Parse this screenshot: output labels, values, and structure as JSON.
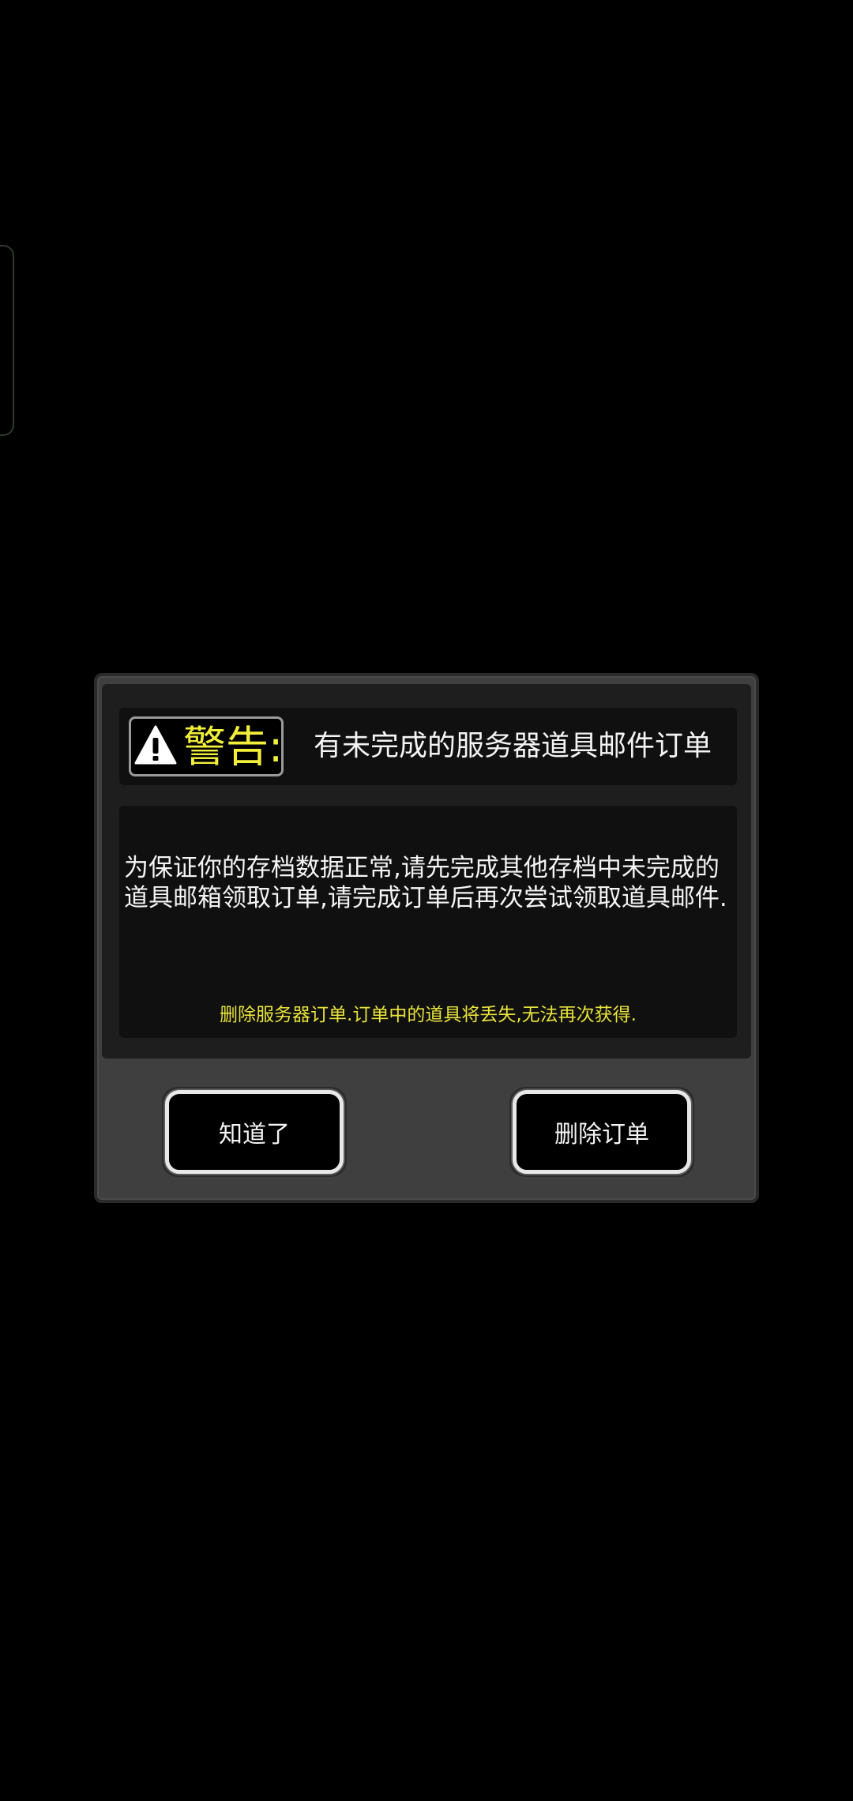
{
  "dialog": {
    "warning_label": "警告:",
    "title": "有未完成的服务器道具邮件订单",
    "message": "为保证你的存档数据正常,请先完成其他存档中未完成的道具邮箱领取订单,请完成订单后再次尝试领取道具邮件.",
    "note": "删除服务器订单.订单中的道具将丢失,无法再次获得.",
    "buttons": {
      "ok_label": "知道了",
      "delete_label": "删除订单"
    },
    "icon": "warning-triangle-icon"
  },
  "colors": {
    "background": "#000000",
    "dialog": "#3f3f3f",
    "panel": "#101010",
    "warning_yellow": "#f2ef3a",
    "note_yellow": "#e8e33a",
    "text": "#f4f4f4"
  }
}
